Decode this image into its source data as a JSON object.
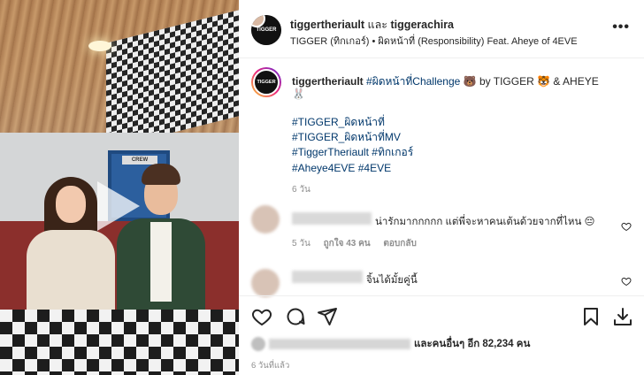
{
  "header": {
    "avatar_label": "TIGGER",
    "user1": "tiggertheriault",
    "and_text": "และ",
    "user2": "tiggerachira",
    "subtitle": "TIGGER (ทิกเกอร์) • ผิดหน้าที่ (Responsibility) Feat. Aheye of 4EVE",
    "more_label": "•••"
  },
  "media": {
    "sign_text": "CREW"
  },
  "caption": {
    "avatar_label": "TIGGER",
    "username": "tiggertheriault",
    "challenge_tag": "#ผิดหน้าที่Challenge",
    "text_after": "🐻 by TIGGER 🐯 & AHEYE",
    "line2": "🐰",
    "hashtags": [
      "#TIGGER_ผิดหน้าที่",
      "#TIGGER_ผิดหน้าที่MV",
      "#TiggerTheriault #ทิกเกอร์",
      "#Aheye4EVE #4EVE"
    ],
    "time": "6 วัน"
  },
  "comments": [
    {
      "text": "น่ารักมากกกกก แต่พี่จะหาคนเต้นด้วยจากที่ไหน 😔",
      "time": "5 วัน",
      "likes": "ถูกใจ 43 คน",
      "reply_label": "ตอบกลับ"
    },
    {
      "text": "จิ้นได้มั้ยคู่นี้"
    }
  ],
  "actions": {
    "like_icon": "heart-icon",
    "comment_icon": "comment-icon",
    "share_icon": "share-icon",
    "save_icon": "bookmark-icon",
    "download_icon": "download-icon"
  },
  "likes_text": "และคนอื่นๆ อีก 82,234 คน",
  "post_time": "6 วันที่แล้ว"
}
